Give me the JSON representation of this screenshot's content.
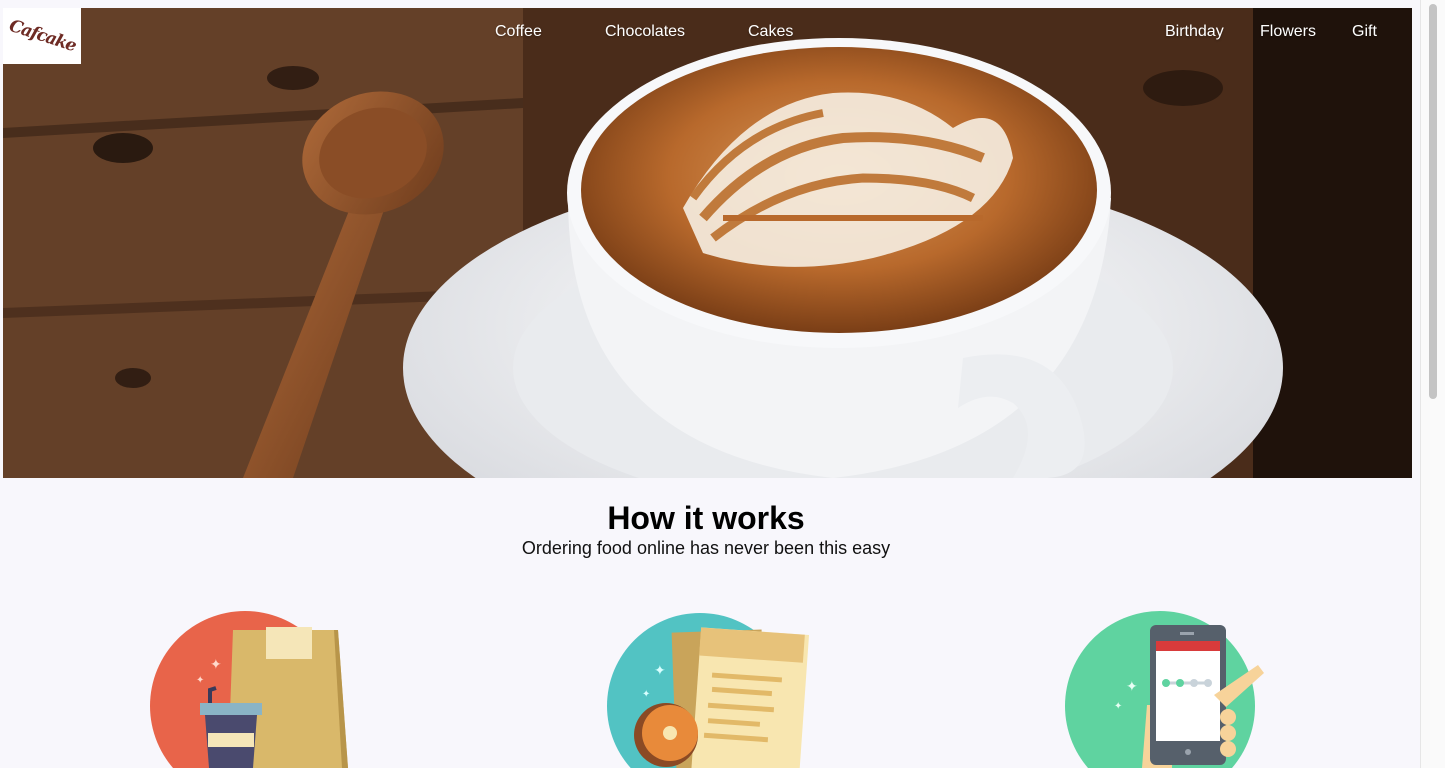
{
  "logo": {
    "text": "Cafcake"
  },
  "nav": {
    "left": [
      "Coffee",
      "Chocolates",
      "Cakes"
    ],
    "right": [
      "Birthday",
      "Flowers",
      "Gift"
    ]
  },
  "how_it_works": {
    "title": "How it works",
    "subtitle": "Ordering food online has never been this easy"
  },
  "colors": {
    "page_bg": "#f8f7fc",
    "step1_circle": "#e8644a",
    "step2_circle": "#52c3c3",
    "step3_circle": "#5fd3a0"
  },
  "icons": [
    "coffee-bag-icon",
    "menu-donut-icon",
    "phone-order-icon"
  ]
}
